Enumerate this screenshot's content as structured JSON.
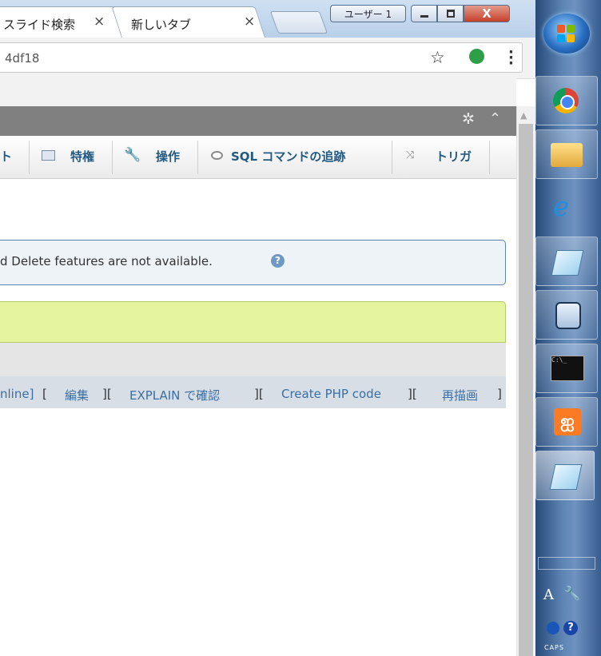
{
  "browser": {
    "tabs": [
      {
        "label": "スライド検索",
        "close": "×"
      },
      {
        "label": "新しいタブ",
        "close": "×"
      }
    ],
    "user_label": "ユーザー 1",
    "close_glyph": "X",
    "address": "4df18"
  },
  "pma": {
    "menu": [
      {
        "label": "ト"
      },
      {
        "label": "特権"
      },
      {
        "label": "操作"
      },
      {
        "label": "SQL コマンドの追跡"
      },
      {
        "label": "トリガ"
      }
    ],
    "notice": "d Delete features are not available.",
    "links": {
      "inline": "nline]",
      "b1": "[",
      "edit": "編集",
      "b2": "][",
      "explain": "EXPLAIN で確認",
      "b3": "][",
      "php": "Create PHP code",
      "b4": "][",
      "refresh": "再描画",
      "b5": "]"
    }
  },
  "taskbar": {
    "tray_a": "A",
    "caps": "CAPS"
  },
  "colors": {
    "menu_link": "#235a81",
    "success_bg": "#e5f59e",
    "notice_border": "#5a85b4",
    "link": "#3a6fa5"
  }
}
